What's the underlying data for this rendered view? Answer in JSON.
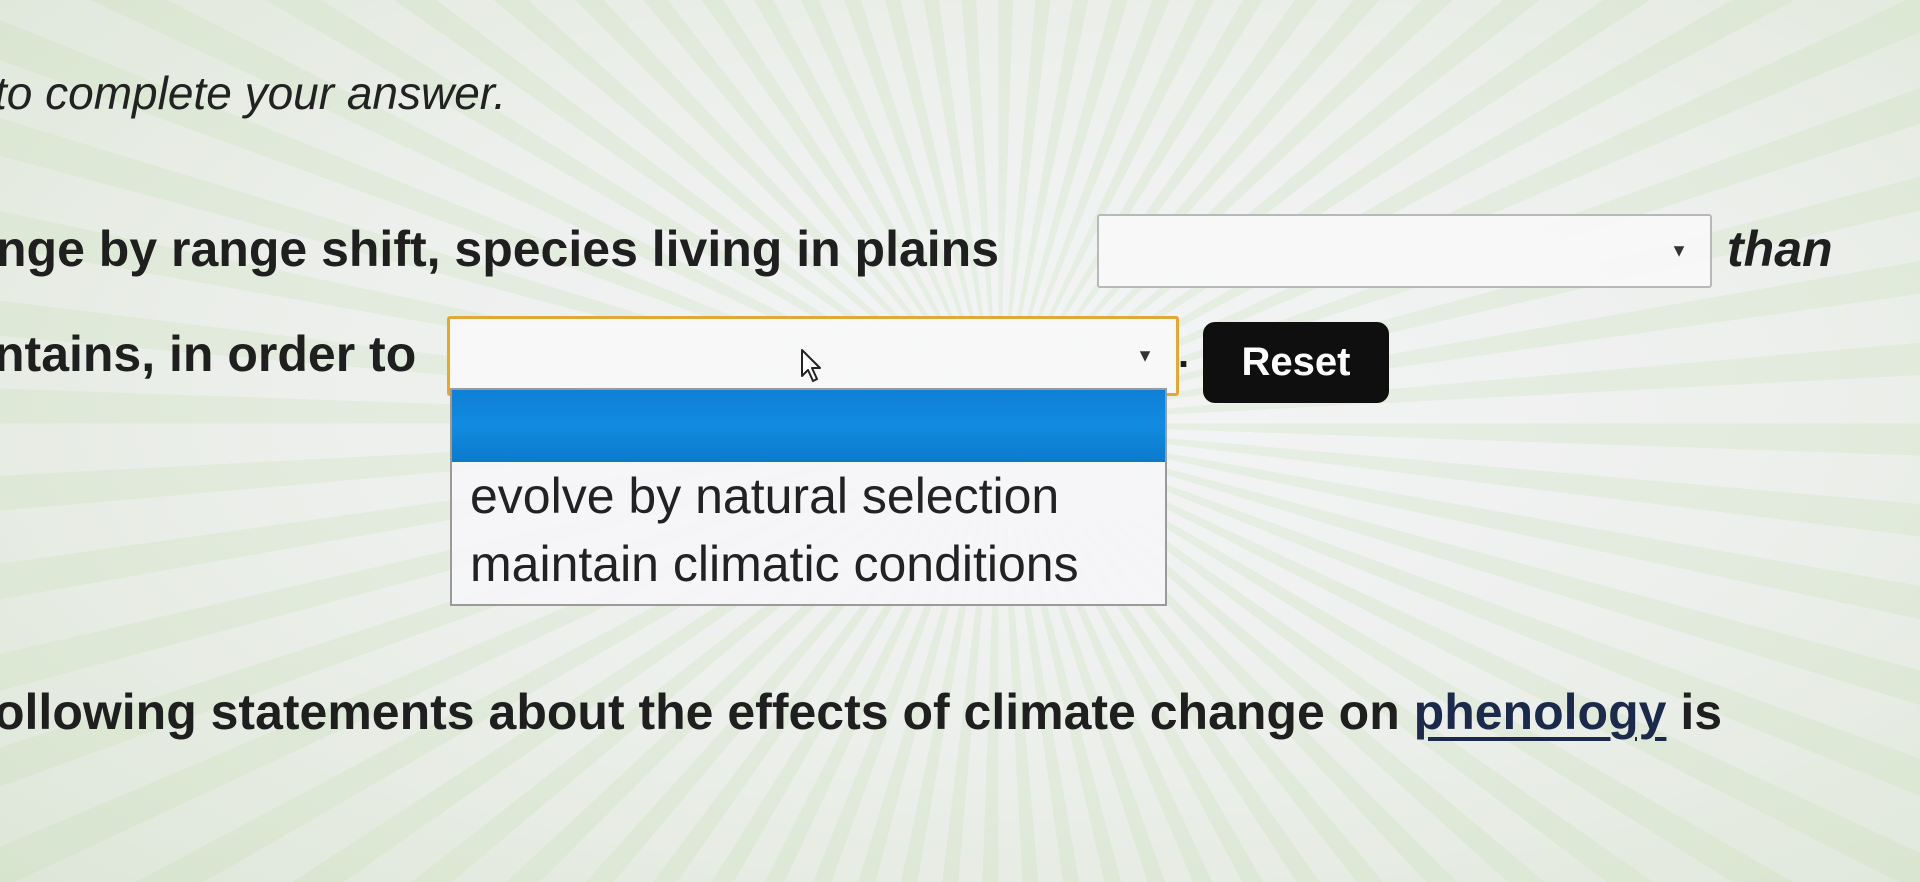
{
  "instructions": "to complete your answer.",
  "question1": {
    "text_before": "nge by range shift, species living in plains",
    "select_value": "",
    "text_after": "than"
  },
  "question1_line2": {
    "text_before": "ntains, in order to",
    "select_value": "",
    "period": ".",
    "reset_label": "Reset"
  },
  "dropdown": {
    "options": [
      "",
      "evolve by natural selection",
      "maintain climatic conditions"
    ],
    "highlighted_index": 0
  },
  "question2": {
    "text_before": "ollowing statements about the effects of climate change on ",
    "link_text": "phenology",
    "text_after": " is"
  },
  "colors": {
    "highlight": "#1188dd",
    "reset_button": "#0f0f10",
    "focus_border": "#e0a838"
  },
  "icons": [
    "caret-down-icon",
    "mouse-cursor-icon"
  ]
}
